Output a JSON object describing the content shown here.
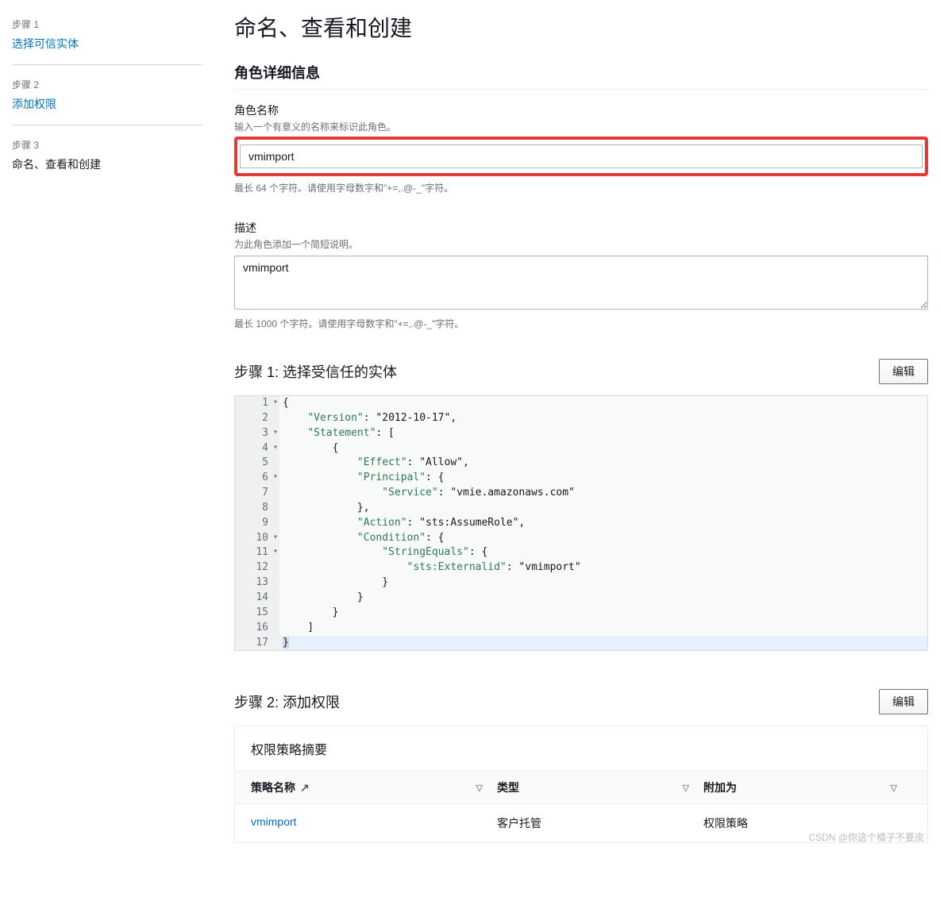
{
  "sidebar": {
    "steps": [
      {
        "num": "步骤 1",
        "label": "选择可信实体",
        "link": true
      },
      {
        "num": "步骤 2",
        "label": "添加权限",
        "link": true
      },
      {
        "num": "步骤 3",
        "label": "命名、查看和创建",
        "link": false
      }
    ]
  },
  "header": {
    "title": "命名、查看和创建"
  },
  "details": {
    "section_title": "角色详细信息",
    "name_label": "角色名称",
    "name_hint": "输入一个有意义的名称来标识此角色。",
    "name_value": "vmimport",
    "name_help": "最长 64 个字符。请使用字母数字和\"+=,.@-_\"字符。",
    "desc_label": "描述",
    "desc_hint": "为此角色添加一个简短说明。",
    "desc_value": "vmimport",
    "desc_help": "最长 1000 个字符。请使用字母数字和\"+=,.@-_\"字符。"
  },
  "step1": {
    "title": "步骤 1: 选择受信任的实体",
    "edit": "编辑",
    "code": [
      "{",
      "    \"Version\": \"2012-10-17\",",
      "    \"Statement\": [",
      "        {",
      "            \"Effect\": \"Allow\",",
      "            \"Principal\": {",
      "                \"Service\": \"vmie.amazonaws.com\"",
      "            },",
      "            \"Action\": \"sts:AssumeRole\",",
      "            \"Condition\": {",
      "                \"StringEquals\": {",
      "                    \"sts:Externalid\": \"vmimport\"",
      "                }",
      "            }",
      "        }",
      "    ]",
      "}"
    ]
  },
  "step2": {
    "title": "步骤 2: 添加权限",
    "edit": "编辑",
    "panel_title": "权限策略摘要",
    "columns": {
      "name": "策略名称",
      "type": "类型",
      "attached": "附加为"
    },
    "rows": [
      {
        "name": "vmimport",
        "type": "客户托管",
        "attached": "权限策略"
      }
    ]
  },
  "watermark": "CSDN @你这个橘子不要皮"
}
